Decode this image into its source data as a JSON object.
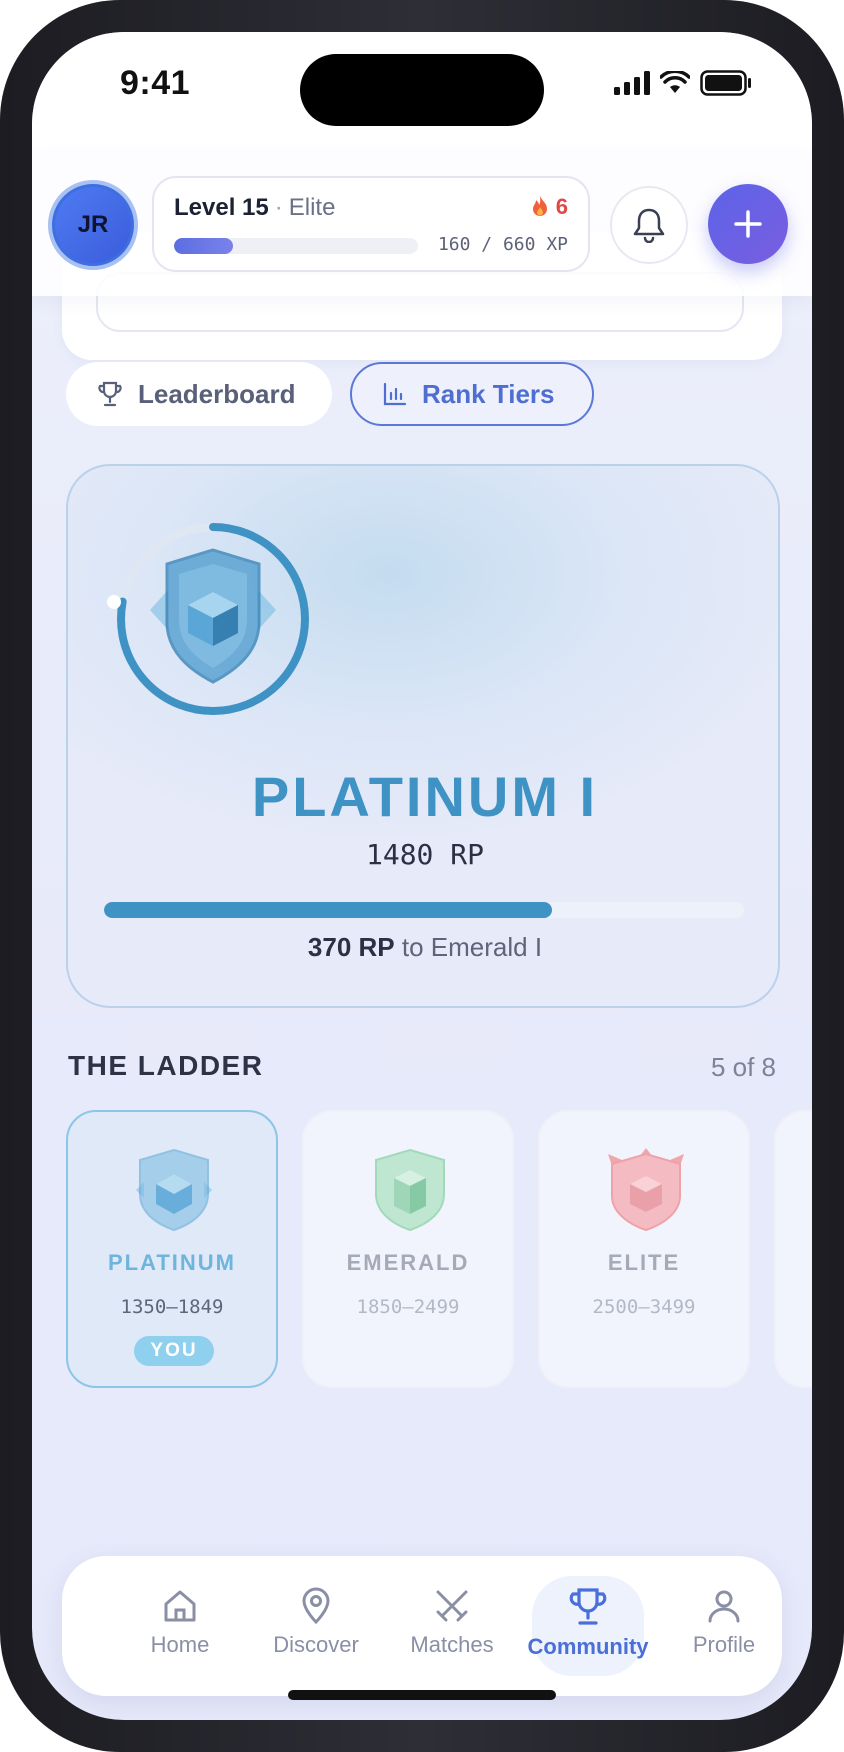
{
  "status_bar": {
    "time": "9:41"
  },
  "header": {
    "avatar_initials": "JR",
    "level_label": "Level 15",
    "level_tier": "Elite",
    "streak_count": "6",
    "xp_text": "160 / 660 XP",
    "xp_progress": 0.2424
  },
  "tabs": [
    {
      "label": "Leaderboard",
      "icon": "trophy-icon",
      "selected": false
    },
    {
      "label": "Rank Tiers",
      "icon": "bar-chart-icon",
      "selected": true
    }
  ],
  "rank": {
    "name": "PLATINUM I",
    "rp": "1480 RP",
    "progress": 0.7,
    "next_amount": "370 RP",
    "next_text": " to Emerald I",
    "color": "#3f92c4"
  },
  "ladder": {
    "title": "THE LADDER",
    "count": "5 of 8",
    "tiers": [
      {
        "name": "PLATINUM",
        "range": "1350–1849",
        "badge": "YOU",
        "color": "#3f92c4"
      },
      {
        "name": "EMERALD",
        "range": "1850–2499",
        "color": "#45b07a"
      },
      {
        "name": "ELITE",
        "range": "2500–3499",
        "color": "#e05a6a"
      }
    ]
  },
  "bottom_nav": [
    {
      "label": "Home",
      "icon": "home-icon"
    },
    {
      "label": "Discover",
      "icon": "map-pin-icon"
    },
    {
      "label": "Matches",
      "icon": "crossed-swords-icon"
    },
    {
      "label": "Community",
      "icon": "trophy-icon",
      "active": true
    },
    {
      "label": "Profile",
      "icon": "user-icon"
    }
  ]
}
